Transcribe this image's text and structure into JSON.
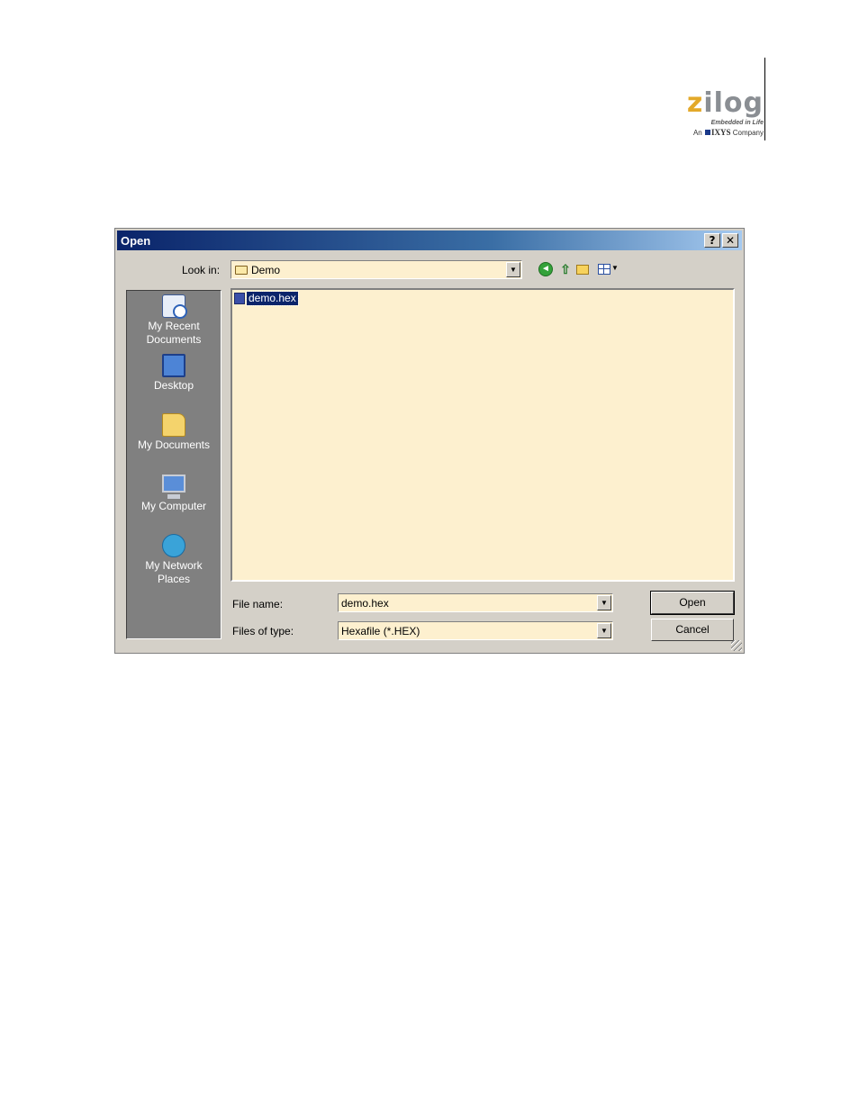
{
  "logo": {
    "word_z": "z",
    "word_rest": "ilog",
    "tagline": "Embedded in Life",
    "company_prefix": "An",
    "company_name": "IXYS",
    "company_suffix": "Company"
  },
  "dialog": {
    "title": "Open",
    "help_glyph": "?",
    "close_glyph": "✕",
    "look_in_label": "Look in:",
    "look_in_value": "Demo",
    "places": [
      {
        "label": "My Recent Documents",
        "icon": "recent-documents-icon"
      },
      {
        "label": "Desktop",
        "icon": "desktop-icon"
      },
      {
        "label": "My Documents",
        "icon": "my-documents-icon"
      },
      {
        "label": "My Computer",
        "icon": "my-computer-icon"
      },
      {
        "label": "My Network Places",
        "icon": "my-network-places-icon"
      }
    ],
    "files": [
      {
        "name": "demo.hex",
        "selected": true
      }
    ],
    "file_name_label": "File name:",
    "file_name_value": "demo.hex",
    "file_type_label": "Files of type:",
    "file_type_value": "Hexafile (*.HEX)",
    "open_button": "Open",
    "cancel_button": "Cancel"
  },
  "colors": {
    "titlebar": "#0a246a",
    "dialog_face": "#d4d0c8",
    "field_background": "#fdf0cf",
    "places_bar": "#808080",
    "logo_accent": "#e3a92a"
  }
}
